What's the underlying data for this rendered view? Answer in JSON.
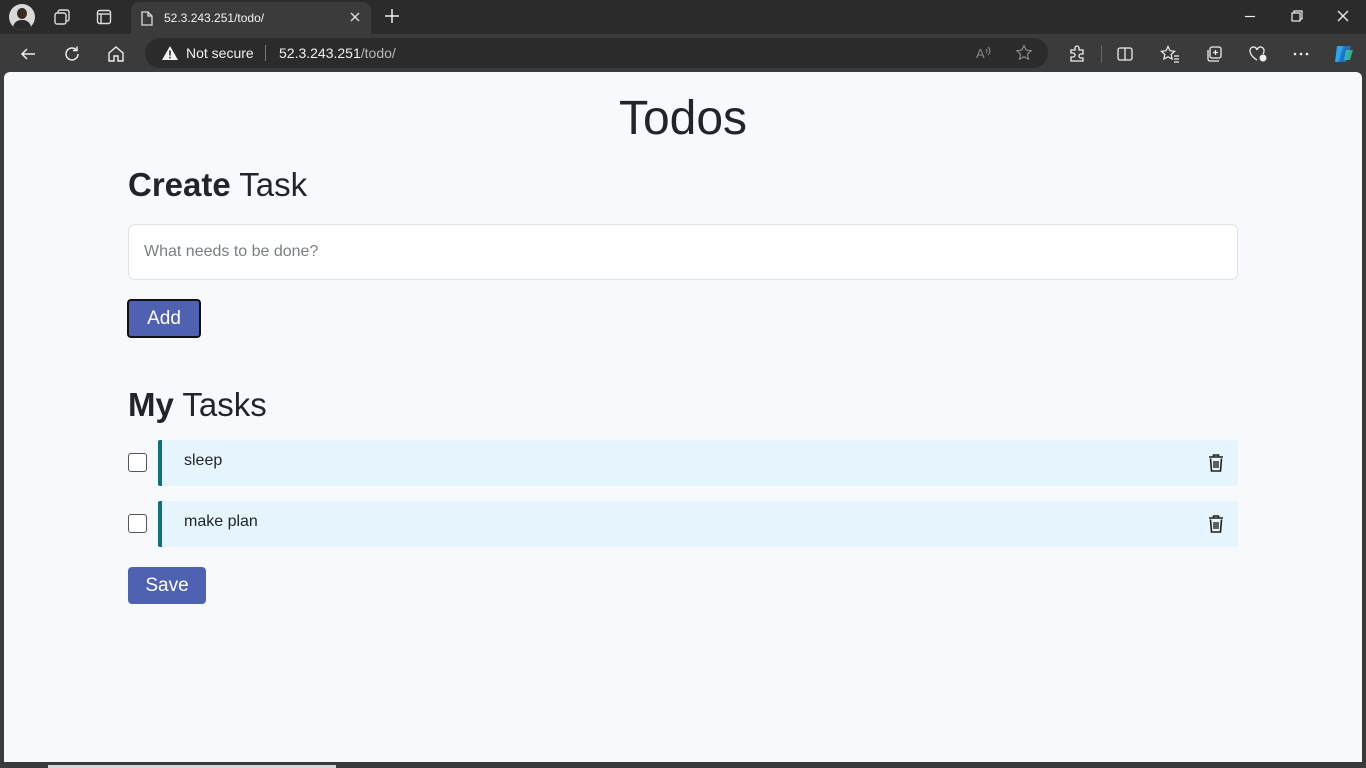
{
  "browser": {
    "tab_title": "52.3.243.251/todo/",
    "security_label": "Not secure",
    "url_host": "52.3.243.251",
    "url_path": "/todo/"
  },
  "page": {
    "title": "Todos",
    "create_heading_bold": "Create",
    "create_heading_rest": " Task",
    "input_placeholder": "What needs to be done?",
    "input_value": "",
    "add_label": "Add",
    "tasks_heading_bold": "My",
    "tasks_heading_rest": " Tasks",
    "tasks": [
      {
        "text": "sleep",
        "checked": false
      },
      {
        "text": "make plan",
        "checked": false
      }
    ],
    "save_label": "Save"
  },
  "colors": {
    "accent": "#4f62b2",
    "task_bg": "#e6f5fd",
    "task_border": "#0d6f80"
  }
}
